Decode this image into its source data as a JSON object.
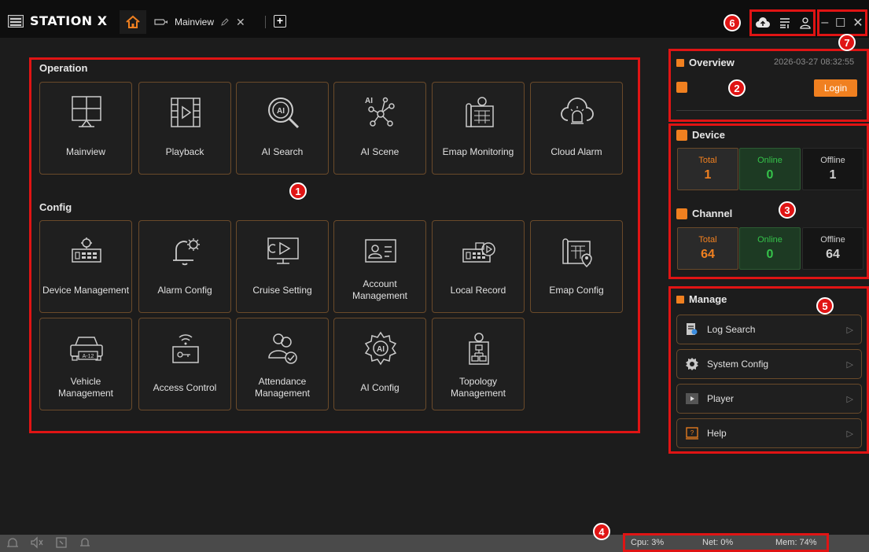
{
  "app": {
    "name": "STATION X"
  },
  "tabs": {
    "main_label": "Mainview"
  },
  "operation": {
    "title": "Operation",
    "items": [
      {
        "label": "Mainview",
        "icon": "grid-monitor-icon"
      },
      {
        "label": "Playback",
        "icon": "film-play-icon"
      },
      {
        "label": "AI Search",
        "icon": "ai-search-icon"
      },
      {
        "label": "AI Scene",
        "icon": "ai-network-icon"
      },
      {
        "label": "Emap Monitoring",
        "icon": "map-building-icon"
      },
      {
        "label": "Cloud Alarm",
        "icon": "cloud-alarm-icon"
      }
    ]
  },
  "config": {
    "title": "Config",
    "items": [
      {
        "label": "Device Management",
        "icon": "device-icon"
      },
      {
        "label": "Alarm Config",
        "icon": "bell-gear-icon"
      },
      {
        "label": "Cruise Setting",
        "icon": "cruise-icon"
      },
      {
        "label": "Account\nManagement",
        "icon": "account-card-icon"
      },
      {
        "label": "Local Record",
        "icon": "local-record-icon"
      },
      {
        "label": "Emap Config",
        "icon": "map-pin-icon"
      },
      {
        "label": "Vehicle Management",
        "icon": "vehicle-icon"
      },
      {
        "label": "Access Control",
        "icon": "access-control-icon"
      },
      {
        "label": "Attendance\nManagement",
        "icon": "attendance-icon"
      },
      {
        "label": "AI Config",
        "icon": "ai-gear-icon"
      },
      {
        "label": "Topology\nManagement",
        "icon": "topology-icon"
      }
    ]
  },
  "overview": {
    "title": "Overview",
    "datetime": "2026-03-27 08:32:55",
    "login_label": "Login"
  },
  "device": {
    "title": "Device",
    "total_label": "Total",
    "total": "1",
    "online_label": "Online",
    "online": "0",
    "offline_label": "Offline",
    "offline": "1"
  },
  "channel": {
    "title": "Channel",
    "total_label": "Total",
    "total": "64",
    "online_label": "Online",
    "online": "0",
    "offline_label": "Offline",
    "offline": "64"
  },
  "manage": {
    "title": "Manage",
    "items": [
      {
        "label": "Log Search",
        "icon": "log-search-icon"
      },
      {
        "label": "System Config",
        "icon": "gear-icon"
      },
      {
        "label": "Player",
        "icon": "player-icon"
      },
      {
        "label": "Help",
        "icon": "help-icon"
      }
    ]
  },
  "status": {
    "cpu": "Cpu: 3%",
    "net": "Net: 0%",
    "mem": "Mem: 74%"
  },
  "badges": [
    "1",
    "2",
    "3",
    "4",
    "5",
    "6",
    "7"
  ],
  "colors": {
    "accent": "#f08020",
    "annotation": "#e01414",
    "online": "#35c24a",
    "tile_border": "#6a4a2a"
  }
}
